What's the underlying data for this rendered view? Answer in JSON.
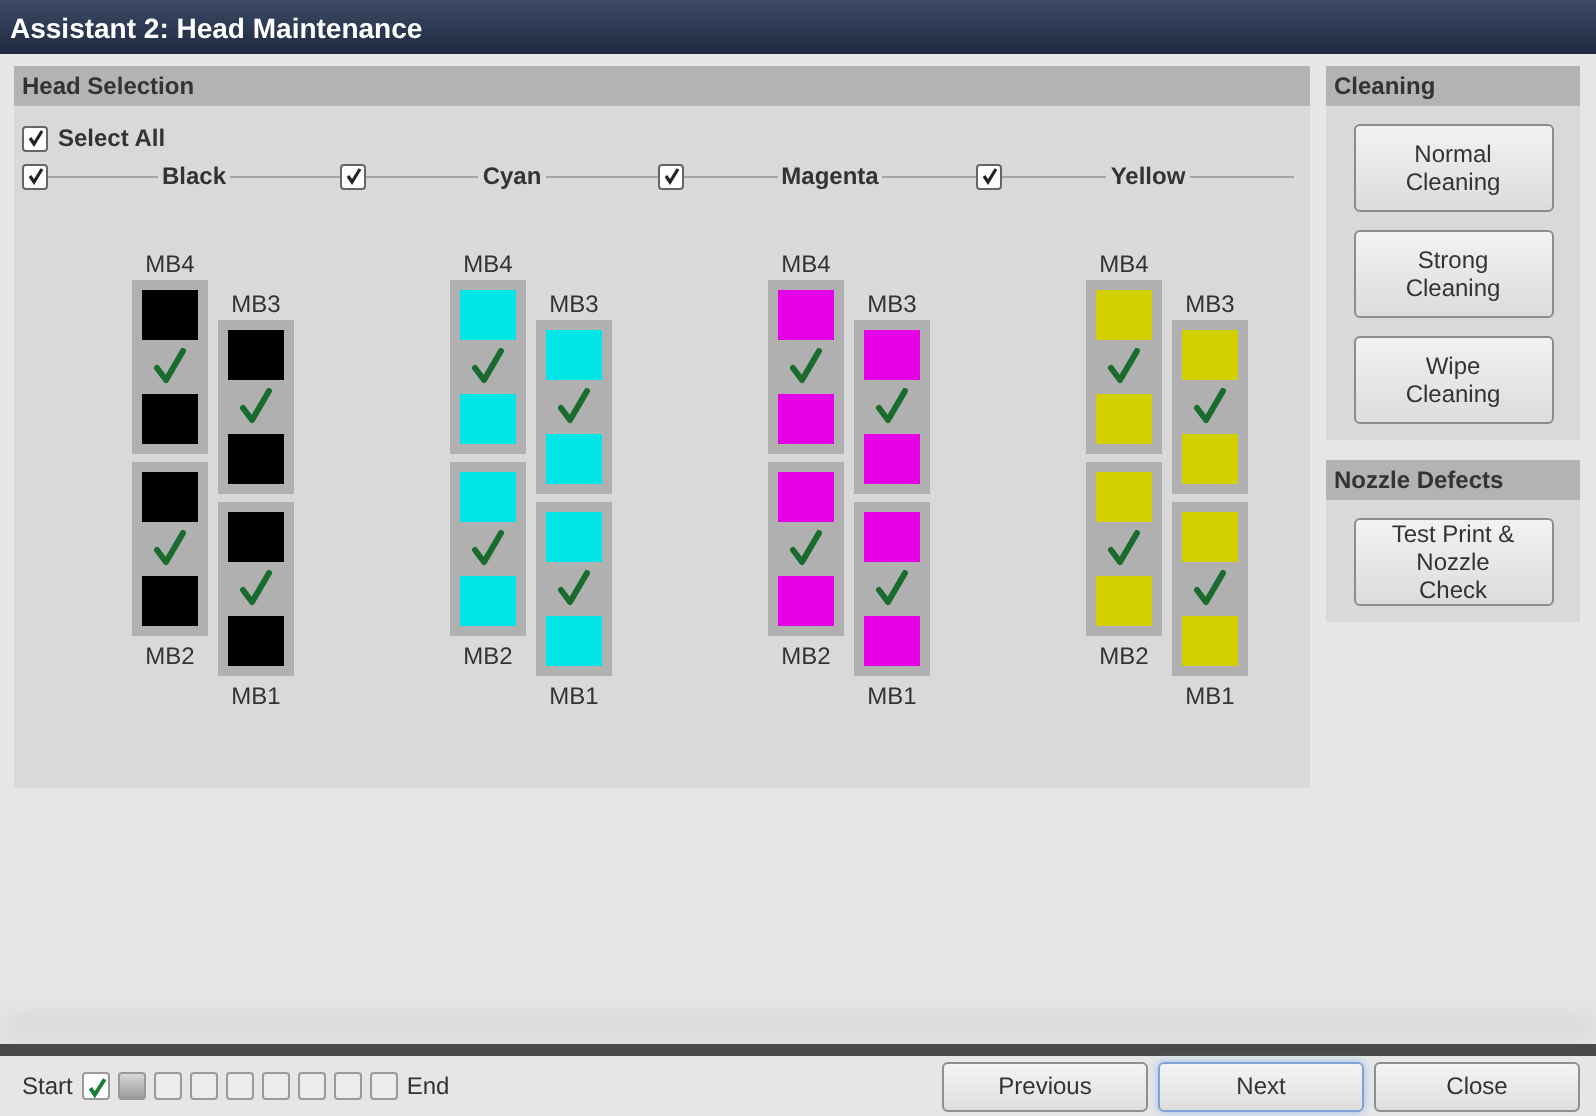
{
  "window": {
    "title": "Assistant 2: Head Maintenance"
  },
  "head_selection": {
    "title": "Head Selection",
    "select_all": {
      "label": "Select All",
      "checked": true
    },
    "colors": [
      {
        "label": "Black",
        "checked": true,
        "color": "#000000",
        "modules": [
          {
            "label": "MB4",
            "checked": true
          },
          {
            "label": "MB3",
            "checked": true
          },
          {
            "label": "MB2",
            "checked": true
          },
          {
            "label": "MB1",
            "checked": true
          }
        ]
      },
      {
        "label": "Cyan",
        "checked": true,
        "color": "#00e5e5",
        "modules": [
          {
            "label": "MB4",
            "checked": true
          },
          {
            "label": "MB3",
            "checked": true
          },
          {
            "label": "MB2",
            "checked": true
          },
          {
            "label": "MB1",
            "checked": true
          }
        ]
      },
      {
        "label": "Magenta",
        "checked": true,
        "color": "#e600e6",
        "modules": [
          {
            "label": "MB4",
            "checked": true
          },
          {
            "label": "MB3",
            "checked": true
          },
          {
            "label": "MB2",
            "checked": true
          },
          {
            "label": "MB1",
            "checked": true
          }
        ]
      },
      {
        "label": "Yellow",
        "checked": true,
        "color": "#d4cf00",
        "modules": [
          {
            "label": "MB4",
            "checked": true
          },
          {
            "label": "MB3",
            "checked": true
          },
          {
            "label": "MB2",
            "checked": true
          },
          {
            "label": "MB1",
            "checked": true
          }
        ]
      }
    ]
  },
  "cleaning": {
    "title": "Cleaning",
    "buttons": [
      "Normal Cleaning",
      "Strong Cleaning",
      "Wipe Cleaning"
    ]
  },
  "nozzle_defects": {
    "title": "Nozzle Defects",
    "buttons": [
      "Test Print & Nozzle Check"
    ]
  },
  "footer": {
    "start": "Start",
    "end": "End",
    "steps": [
      {
        "checked": true,
        "selected": false
      },
      {
        "checked": false,
        "selected": true
      },
      {
        "checked": false,
        "selected": false
      },
      {
        "checked": false,
        "selected": false
      },
      {
        "checked": false,
        "selected": false
      },
      {
        "checked": false,
        "selected": false
      },
      {
        "checked": false,
        "selected": false
      },
      {
        "checked": false,
        "selected": false
      },
      {
        "checked": false,
        "selected": false
      }
    ],
    "buttons": [
      {
        "label": "Previous",
        "selected": false
      },
      {
        "label": "Next",
        "selected": true
      },
      {
        "label": "Close",
        "selected": false
      }
    ]
  }
}
